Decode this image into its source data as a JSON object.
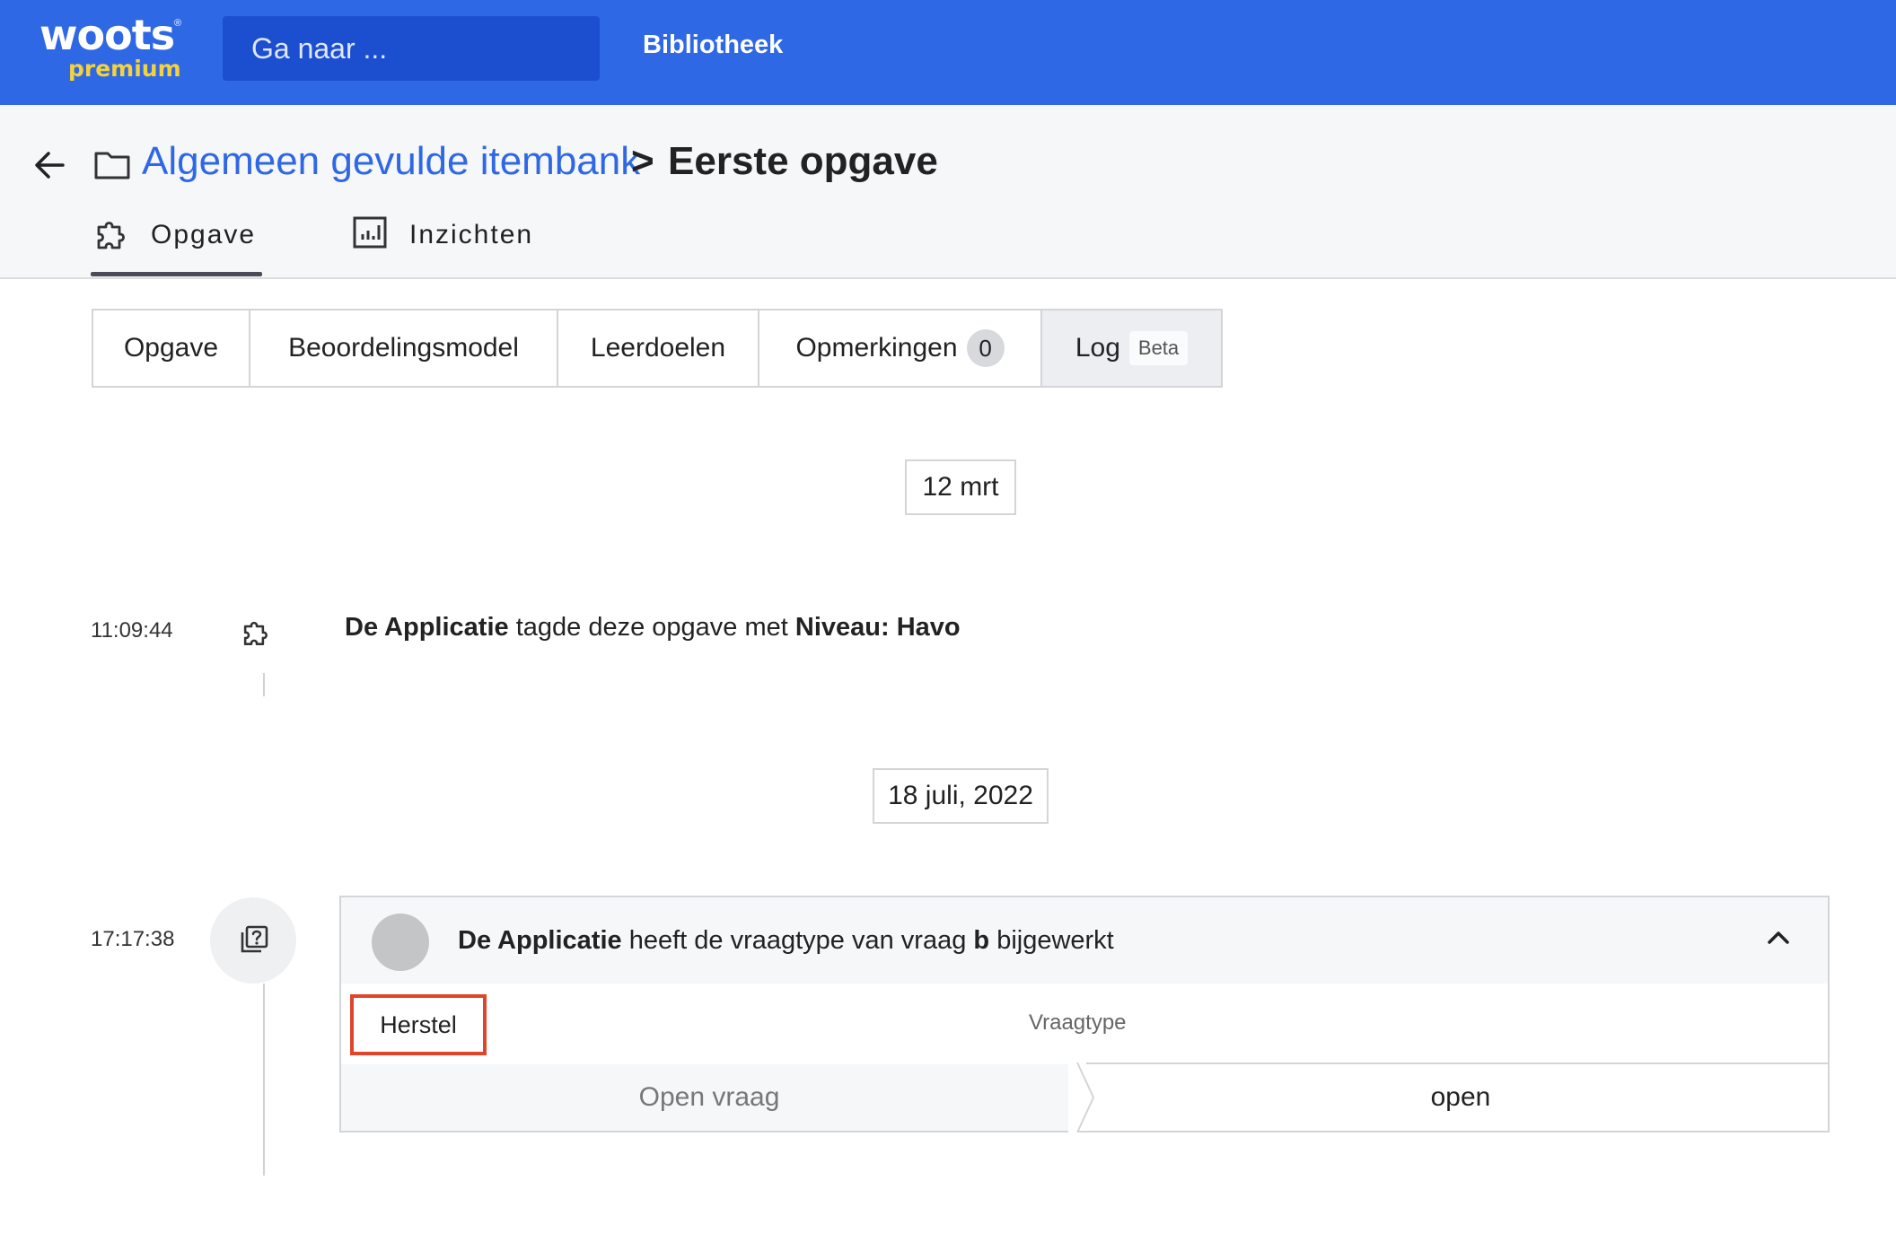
{
  "topbar": {
    "logo_text": "woots",
    "logo_sub": "premium",
    "logo_reg": "®",
    "search_placeholder": "Ga naar ...",
    "nav_link": "Bibliotheek",
    "brand_color": "#2f68e5",
    "accent_color": "#f4d23b"
  },
  "breadcrumb": {
    "folder": "Algemeen gevulde itembank",
    "separator": ">",
    "current": "Eerste opgave"
  },
  "main_tabs": [
    {
      "label": "Opgave",
      "icon": "puzzle-icon",
      "active": true
    },
    {
      "label": "Inzichten",
      "icon": "chart-icon",
      "active": false
    }
  ],
  "segment_tabs": {
    "items": [
      "Opgave",
      "Beoordelingsmodel",
      "Leerdoelen",
      "Opmerkingen",
      "Log"
    ],
    "opmerkingen_count": "0",
    "log_badge": "Beta",
    "active": "Log"
  },
  "log": {
    "groups": [
      {
        "date": "12 mrt",
        "entries": [
          {
            "time": "11:09:44",
            "icon": "puzzle-icon",
            "actor": "De Applicatie",
            "text": "tagde deze opgave met",
            "tag": "Niveau: Havo"
          }
        ]
      },
      {
        "date": "18 juli, 2022",
        "entries": [
          {
            "time": "17:17:38",
            "icon": "question-copy-icon",
            "actor": "De Applicatie",
            "text_before": "heeft de vraagtype van vraag",
            "question": "b",
            "text_after": "bijgewerkt",
            "restore_label": "Herstel",
            "column_header": "Vraagtype",
            "old_value": "Open vraag",
            "new_value": "open"
          }
        ]
      }
    ]
  },
  "highlight_color": "#e0442a"
}
